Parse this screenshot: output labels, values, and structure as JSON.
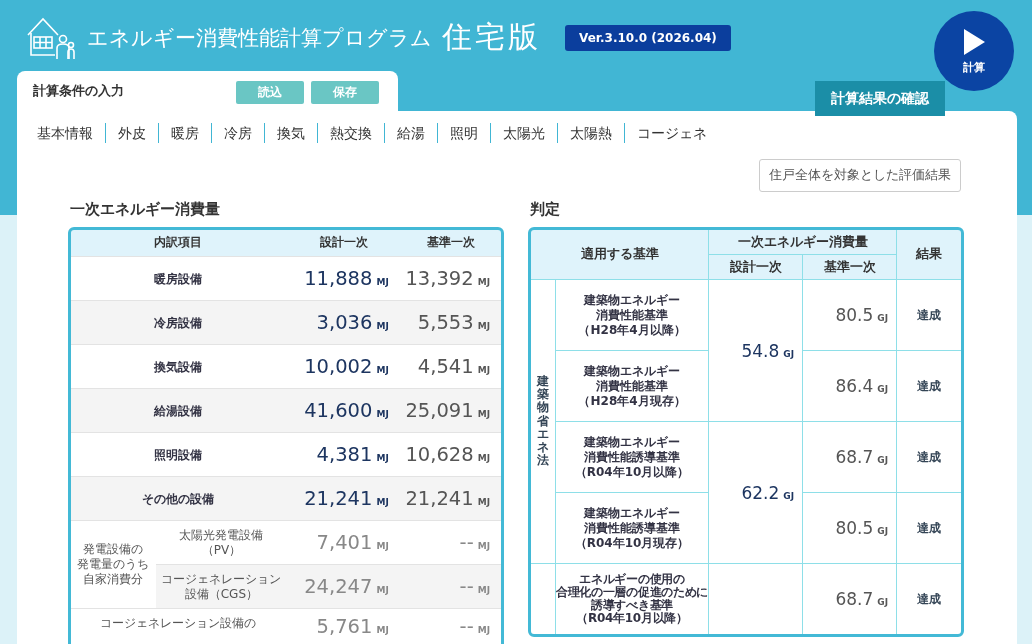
{
  "app": {
    "title": "エネルギー消費性能計算プログラム",
    "edition": "住宅版",
    "version": "Ver.3.10.0 (2026.04)",
    "run_button": "計算"
  },
  "input_tab": {
    "label": "計算条件の入力",
    "buttons": [
      "読込",
      "保存"
    ]
  },
  "results_label": "計算結果の確認",
  "nav": [
    "基本情報",
    "外皮",
    "暖房",
    "冷房",
    "換気",
    "熱交換",
    "給湯",
    "照明",
    "太陽光",
    "太陽熱",
    "コージェネ"
  ],
  "evaluation_button": "住戸全体を対象とした評価結果",
  "energy": {
    "title": "一次エネルギー消費量",
    "columns": [
      "内訳項目",
      "設計一次",
      "基準一次"
    ],
    "rows": [
      {
        "kind": "main",
        "label": [
          "暖房設備"
        ],
        "design": "11,888",
        "design_unit": "MJ",
        "reference": "13,392",
        "reference_unit": "MJ"
      },
      {
        "kind": "main",
        "label": [
          "冷房設備"
        ],
        "design": "3,036",
        "design_unit": "MJ",
        "reference": "5,553",
        "reference_unit": "MJ"
      },
      {
        "kind": "main",
        "label": [
          "換気設備"
        ],
        "design": "10,002",
        "design_unit": "MJ",
        "reference": "4,541",
        "reference_unit": "MJ"
      },
      {
        "kind": "main",
        "label": [
          "給湯設備"
        ],
        "design": "41,600",
        "design_unit": "MJ",
        "reference": "25,091",
        "reference_unit": "MJ"
      },
      {
        "kind": "main",
        "label": [
          "照明設備"
        ],
        "design": "4,381",
        "design_unit": "MJ",
        "reference": "10,628",
        "reference_unit": "MJ"
      },
      {
        "kind": "main",
        "label": [
          "その他の設備"
        ],
        "design": "21,241",
        "design_unit": "MJ",
        "reference": "21,241",
        "reference_unit": "MJ"
      },
      {
        "kind": "group",
        "label": [
          "発電設備の",
          "発電量のうち",
          "自家消費分"
        ],
        "rows": [
          {
            "label": [
              "太陽光発電設備",
              "（PV）"
            ],
            "design": "7,401",
            "design_unit": "MJ",
            "reference": "--",
            "reference_unit": "MJ"
          },
          {
            "label": [
              "コージェネレーション",
              "設備（CGS）"
            ],
            "design": "24,247",
            "design_unit": "MJ",
            "reference": "--",
            "reference_unit": "MJ"
          }
        ]
      },
      {
        "kind": "deduction",
        "label": [
          "コージェネレーション設備の"
        ],
        "design": "5,761",
        "design_unit": "MJ",
        "reference": "--",
        "reference_unit": "MJ"
      }
    ]
  },
  "judgement": {
    "title": "判定",
    "columns": {
      "standard": "適用する基準",
      "energy": "一次エネルギー消費量",
      "design": "設計一次",
      "reference": "基準一次",
      "result": "結果"
    },
    "groups": [
      {
        "law": "建築物省エネ法",
        "pairs": [
          {
            "design": "54.8",
            "design_unit": "GJ",
            "criteria": [
              {
                "name": [
                  "建築物エネルギー",
                  "消費性能基準",
                  "（H28年4月以降）"
                ],
                "reference": "80.5",
                "reference_unit": "GJ",
                "result": "達成"
              },
              {
                "name": [
                  "建築物エネルギー",
                  "消費性能基準",
                  "（H28年4月現存）"
                ],
                "reference": "86.4",
                "reference_unit": "GJ",
                "result": "達成"
              }
            ]
          },
          {
            "design": "62.2",
            "design_unit": "GJ",
            "criteria": [
              {
                "name": [
                  "建築物エネルギー",
                  "消費性能誘導基準",
                  "（R04年10月以降）"
                ],
                "reference": "68.7",
                "reference_unit": "GJ",
                "result": "達成"
              },
              {
                "name": [
                  "建築物エネルギー",
                  "消費性能誘導基準",
                  "（R04年10月現存）"
                ],
                "reference": "80.5",
                "reference_unit": "GJ",
                "result": "達成"
              }
            ]
          }
        ]
      },
      {
        "pairs": [
          {
            "criteria": [
              {
                "name": [
                  "エネルギーの使用の",
                  "合理化の一層の促進のために",
                  "誘導すべき基準",
                  "（R04年10月以降）"
                ],
                "reference": "68.7",
                "reference_unit": "GJ",
                "result": "達成"
              }
            ]
          }
        ]
      }
    ]
  }
}
